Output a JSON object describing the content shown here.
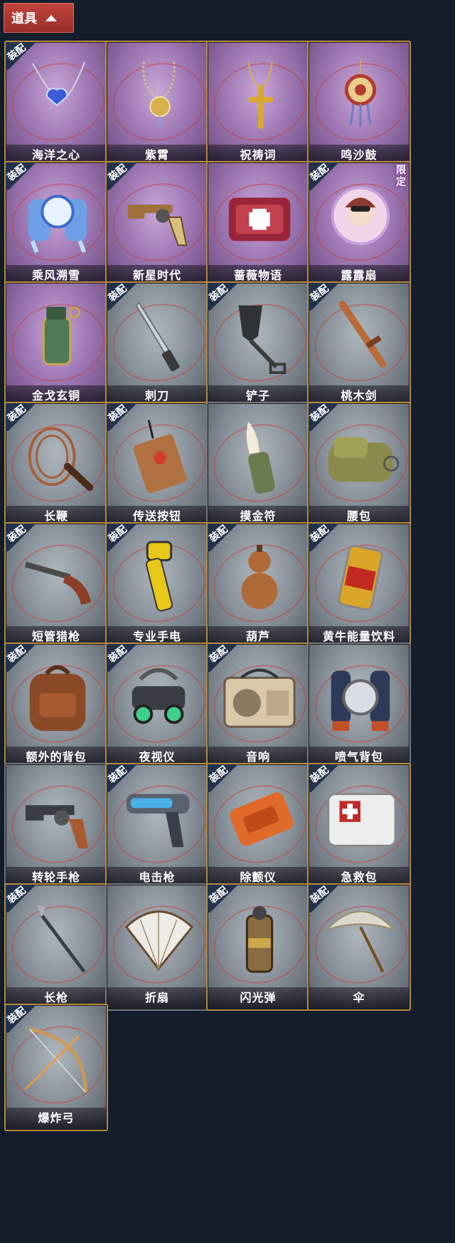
{
  "header": {
    "title": "道具"
  },
  "labels": {
    "equip": "装配",
    "limited": "限定"
  },
  "items": [
    {
      "name": "海洋之心",
      "tier": "purple",
      "equipped": true,
      "icon": "heart-necklace-icon"
    },
    {
      "name": "紫霄",
      "tier": "purple",
      "equipped": false,
      "icon": "beaded-pendant-icon"
    },
    {
      "name": "祝祷词",
      "tier": "purple",
      "equipped": false,
      "icon": "cross-pendant-icon"
    },
    {
      "name": "鸣沙鼓",
      "tier": "purple",
      "equipped": false,
      "icon": "drum-charm-icon"
    },
    {
      "name": "乘风溯雪",
      "tier": "purple",
      "equipped": true,
      "icon": "jetpack-snow-icon"
    },
    {
      "name": "新星时代",
      "tier": "purple",
      "equipped": true,
      "icon": "revolver-icon"
    },
    {
      "name": "蔷薇物语",
      "tier": "purple",
      "equipped": false,
      "icon": "medical-box-icon"
    },
    {
      "name": "露露扇",
      "tier": "purple",
      "equipped": true,
      "limited": true,
      "icon": "portrait-fan-icon"
    },
    {
      "name": "金戈玄铜",
      "tier": "purple",
      "equipped": false,
      "icon": "grenade-icon"
    },
    {
      "name": "刺刀",
      "tier": "gray",
      "equipped": true,
      "icon": "knife-icon"
    },
    {
      "name": "铲子",
      "tier": "gray",
      "equipped": true,
      "icon": "shovel-icon"
    },
    {
      "name": "桃木剑",
      "tier": "gray",
      "equipped": true,
      "icon": "wooden-sword-icon"
    },
    {
      "name": "长鞭",
      "tier": "gray",
      "equipped": true,
      "icon": "whip-icon"
    },
    {
      "name": "传送按钮",
      "tier": "gray",
      "equipped": true,
      "icon": "remote-button-icon"
    },
    {
      "name": "摸金符",
      "tier": "gray",
      "equipped": false,
      "icon": "tooth-charm-icon"
    },
    {
      "name": "腰包",
      "tier": "gray",
      "equipped": true,
      "icon": "waist-bag-icon"
    },
    {
      "name": "短管猎枪",
      "tier": "gray",
      "equipped": true,
      "icon": "shotgun-icon"
    },
    {
      "name": "专业手电",
      "tier": "gray",
      "equipped": true,
      "icon": "flashlight-icon"
    },
    {
      "name": "葫芦",
      "tier": "gray",
      "equipped": true,
      "icon": "gourd-icon"
    },
    {
      "name": "黄牛能量饮料",
      "tier": "gray",
      "equipped": true,
      "icon": "energy-drink-icon"
    },
    {
      "name": "额外的背包",
      "tier": "gray",
      "equipped": true,
      "icon": "backpack-icon"
    },
    {
      "name": "夜视仪",
      "tier": "gray",
      "equipped": true,
      "icon": "night-vision-icon"
    },
    {
      "name": "音响",
      "tier": "gray",
      "equipped": true,
      "icon": "radio-icon"
    },
    {
      "name": "喷气背包",
      "tier": "gray",
      "equipped": false,
      "icon": "jetpack-icon"
    },
    {
      "name": "转轮手枪",
      "tier": "gray",
      "equipped": false,
      "icon": "revolver-gray-icon"
    },
    {
      "name": "电击枪",
      "tier": "gray",
      "equipped": true,
      "icon": "taser-gun-icon"
    },
    {
      "name": "除颤仪",
      "tier": "gray",
      "equipped": true,
      "icon": "defibrillator-icon"
    },
    {
      "name": "急救包",
      "tier": "gray",
      "equipped": true,
      "icon": "first-aid-kit-icon"
    },
    {
      "name": "长枪",
      "tier": "gray",
      "equipped": true,
      "icon": "spear-icon"
    },
    {
      "name": "折扇",
      "tier": "gray",
      "equipped": false,
      "icon": "folding-fan-icon"
    },
    {
      "name": "闪光弹",
      "tier": "gray",
      "equipped": true,
      "icon": "flashbang-icon"
    },
    {
      "name": "伞",
      "tier": "gray",
      "equipped": true,
      "icon": "umbrella-icon"
    },
    {
      "name": "爆炸弓",
      "tier": "gray",
      "equipped": true,
      "icon": "bow-icon"
    }
  ],
  "colors": {
    "background": "#131d2b",
    "header_tab": "#a8332e",
    "card_gold_border": "#b68a42",
    "card_purple": "#9f78b3",
    "card_gray": "#8a939b",
    "equip_badge": "#23324c"
  }
}
